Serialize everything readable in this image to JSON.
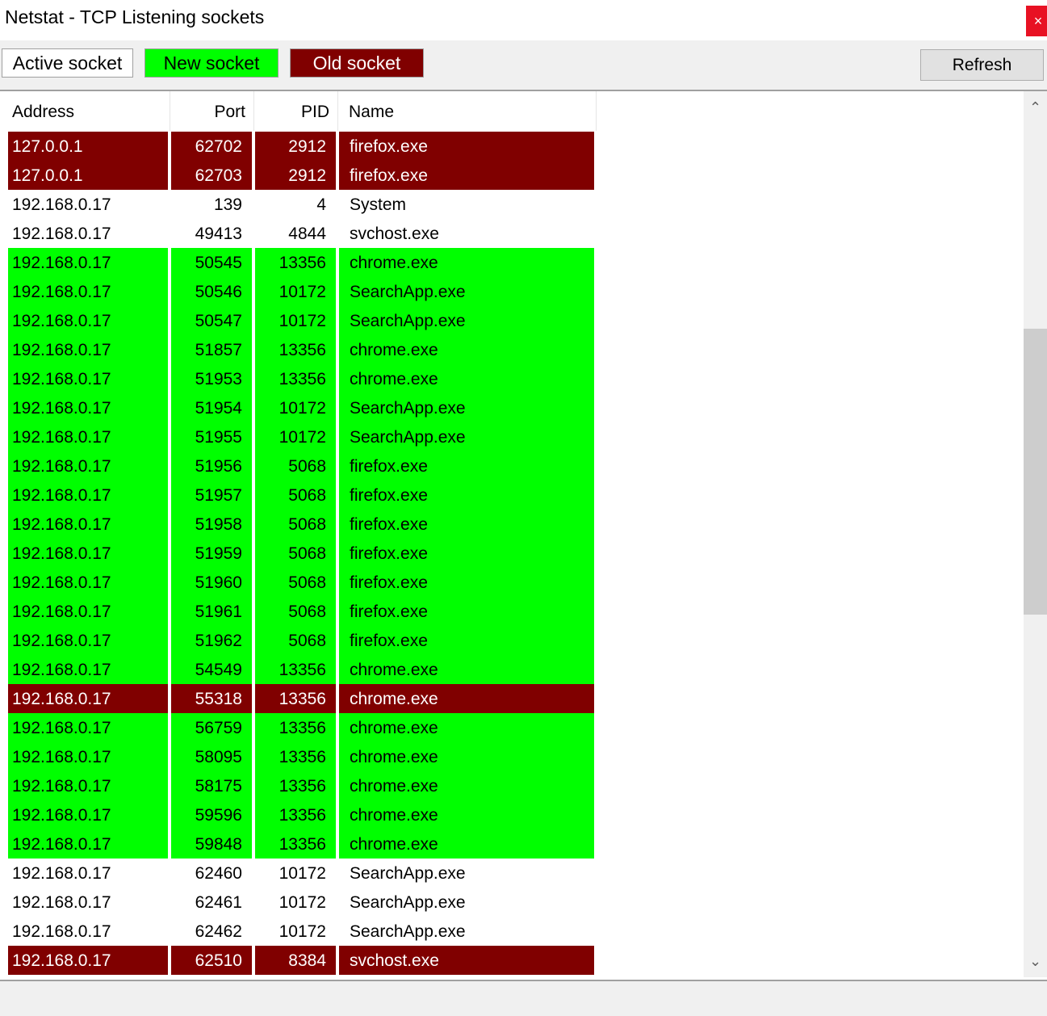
{
  "window": {
    "title": "Netstat - TCP Listening sockets",
    "close_label": "×"
  },
  "legend": {
    "active_label": "Active socket",
    "new_label": "New socket",
    "old_label": "Old socket",
    "colors": {
      "active": "#ffffff",
      "new": "#00ff00",
      "old": "#800000"
    }
  },
  "toolbar": {
    "refresh_label": "Refresh"
  },
  "table": {
    "columns": [
      "Address",
      "Port",
      "PID",
      "Name"
    ],
    "rows": [
      {
        "address": "127.0.0.1",
        "port": "62702",
        "pid": "2912",
        "name": "firefox.exe",
        "state": "old"
      },
      {
        "address": "127.0.0.1",
        "port": "62703",
        "pid": "2912",
        "name": "firefox.exe",
        "state": "old"
      },
      {
        "address": "192.168.0.17",
        "port": "139",
        "pid": "4",
        "name": "System",
        "state": "active"
      },
      {
        "address": "192.168.0.17",
        "port": "49413",
        "pid": "4844",
        "name": "svchost.exe",
        "state": "active"
      },
      {
        "address": "192.168.0.17",
        "port": "50545",
        "pid": "13356",
        "name": "chrome.exe",
        "state": "new"
      },
      {
        "address": "192.168.0.17",
        "port": "50546",
        "pid": "10172",
        "name": "SearchApp.exe",
        "state": "new"
      },
      {
        "address": "192.168.0.17",
        "port": "50547",
        "pid": "10172",
        "name": "SearchApp.exe",
        "state": "new"
      },
      {
        "address": "192.168.0.17",
        "port": "51857",
        "pid": "13356",
        "name": "chrome.exe",
        "state": "new"
      },
      {
        "address": "192.168.0.17",
        "port": "51953",
        "pid": "13356",
        "name": "chrome.exe",
        "state": "new"
      },
      {
        "address": "192.168.0.17",
        "port": "51954",
        "pid": "10172",
        "name": "SearchApp.exe",
        "state": "new"
      },
      {
        "address": "192.168.0.17",
        "port": "51955",
        "pid": "10172",
        "name": "SearchApp.exe",
        "state": "new"
      },
      {
        "address": "192.168.0.17",
        "port": "51956",
        "pid": "5068",
        "name": "firefox.exe",
        "state": "new"
      },
      {
        "address": "192.168.0.17",
        "port": "51957",
        "pid": "5068",
        "name": "firefox.exe",
        "state": "new"
      },
      {
        "address": "192.168.0.17",
        "port": "51958",
        "pid": "5068",
        "name": "firefox.exe",
        "state": "new"
      },
      {
        "address": "192.168.0.17",
        "port": "51959",
        "pid": "5068",
        "name": "firefox.exe",
        "state": "new"
      },
      {
        "address": "192.168.0.17",
        "port": "51960",
        "pid": "5068",
        "name": "firefox.exe",
        "state": "new"
      },
      {
        "address": "192.168.0.17",
        "port": "51961",
        "pid": "5068",
        "name": "firefox.exe",
        "state": "new"
      },
      {
        "address": "192.168.0.17",
        "port": "51962",
        "pid": "5068",
        "name": "firefox.exe",
        "state": "new"
      },
      {
        "address": "192.168.0.17",
        "port": "54549",
        "pid": "13356",
        "name": "chrome.exe",
        "state": "new"
      },
      {
        "address": "192.168.0.17",
        "port": "55318",
        "pid": "13356",
        "name": "chrome.exe",
        "state": "old"
      },
      {
        "address": "192.168.0.17",
        "port": "56759",
        "pid": "13356",
        "name": "chrome.exe",
        "state": "new"
      },
      {
        "address": "192.168.0.17",
        "port": "58095",
        "pid": "13356",
        "name": "chrome.exe",
        "state": "new"
      },
      {
        "address": "192.168.0.17",
        "port": "58175",
        "pid": "13356",
        "name": "chrome.exe",
        "state": "new"
      },
      {
        "address": "192.168.0.17",
        "port": "59596",
        "pid": "13356",
        "name": "chrome.exe",
        "state": "new"
      },
      {
        "address": "192.168.0.17",
        "port": "59848",
        "pid": "13356",
        "name": "chrome.exe",
        "state": "new"
      },
      {
        "address": "192.168.0.17",
        "port": "62460",
        "pid": "10172",
        "name": "SearchApp.exe",
        "state": "active"
      },
      {
        "address": "192.168.0.17",
        "port": "62461",
        "pid": "10172",
        "name": "SearchApp.exe",
        "state": "active"
      },
      {
        "address": "192.168.0.17",
        "port": "62462",
        "pid": "10172",
        "name": "SearchApp.exe",
        "state": "active"
      },
      {
        "address": "192.168.0.17",
        "port": "62510",
        "pid": "8384",
        "name": "svchost.exe",
        "state": "old"
      }
    ]
  },
  "scrollbar": {
    "up_icon": "chevron-up-icon",
    "down_icon": "chevron-down-icon"
  }
}
